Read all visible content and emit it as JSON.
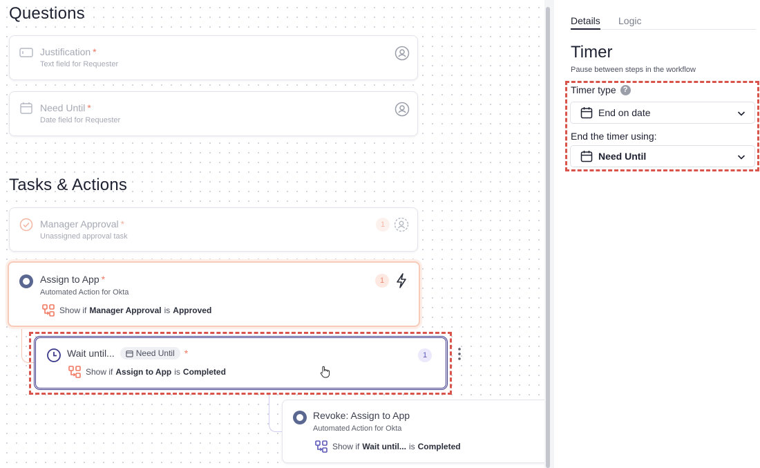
{
  "canvas": {
    "questions_heading": "Questions",
    "questions": [
      {
        "title": "Justification",
        "required": "*",
        "subtitle": "Text field for Requester",
        "icon": "text-field-icon"
      },
      {
        "title": "Need Until",
        "required": "*",
        "subtitle": "Date field for Requester",
        "icon": "calendar-icon"
      }
    ],
    "tasks_heading": "Tasks & Actions",
    "manager_approval": {
      "title": "Manager Approval",
      "required": "*",
      "subtitle": "Unassigned approval task",
      "count": "1"
    },
    "assign_to_app": {
      "title": "Assign to App",
      "required": "*",
      "subtitle": "Automated Action for Okta",
      "count": "1",
      "condition": {
        "prefix": "Show if",
        "subject": "Manager Approval",
        "verb": "is",
        "value": "Approved"
      }
    },
    "wait_until": {
      "title": "Wait until...",
      "chip": "Need Until",
      "required": "*",
      "count": "1",
      "condition": {
        "prefix": "Show if",
        "subject": "Assign to App",
        "verb": "is",
        "value": "Completed"
      }
    },
    "revoke": {
      "title": "Revoke: Assign to App",
      "subtitle": "Automated Action for Okta",
      "condition": {
        "prefix": "Show if",
        "subject": "Wait until...",
        "verb": "is",
        "value": "Completed"
      }
    }
  },
  "panel": {
    "tabs": [
      "Details",
      "Logic"
    ],
    "active_tab": "Details",
    "title": "Timer",
    "subtitle": "Pause between steps in the workflow",
    "timer_type_label": "Timer type",
    "timer_type_value": "End on date",
    "end_using_label": "End the timer using:",
    "end_using_value": "Need Until"
  },
  "colors": {
    "accent_orange": "#f07860",
    "highlight_red": "#d9544a",
    "selected_purple": "#3d3a8c",
    "navy": "#5a6791"
  }
}
